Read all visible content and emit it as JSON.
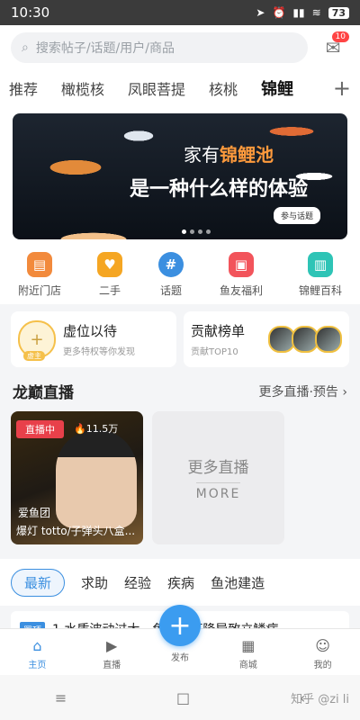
{
  "status": {
    "time": "10:30",
    "battery": "73"
  },
  "search": {
    "placeholder": "搜索帖子/话题/用户/商品",
    "badge": "10"
  },
  "tabs": [
    "推荐",
    "橄榄核",
    "凤眼菩提",
    "核桃",
    "锦鲤"
  ],
  "banner": {
    "line1_pre": "家有",
    "line1_em": "锦鲤池",
    "line2": "是一种什么样的体验",
    "button": "参与话题"
  },
  "categories": [
    {
      "label": "附近门店",
      "icon": "store-icon",
      "color": "#f28a3c"
    },
    {
      "label": "二手",
      "icon": "handshake-icon",
      "color": "#f5a623"
    },
    {
      "label": "话题",
      "icon": "hashtag-icon",
      "color": "#3b8fe0"
    },
    {
      "label": "鱼友福利",
      "icon": "gift-icon",
      "color": "#f2545b"
    },
    {
      "label": "锦鲤百科",
      "icon": "book-icon",
      "color": "#2ec4b6"
    }
  ],
  "seat_card": {
    "title": "虚位以待",
    "sub": "更多特权等你发现",
    "mini": "虚主"
  },
  "rank_card": {
    "title": "贡献榜单",
    "sub": "贡献TOP10"
  },
  "live_section": {
    "title": "龙巅直播",
    "more": "更多直播·预告"
  },
  "live_card": {
    "badge": "直播中",
    "viewers": "11.5万",
    "author": "爱鱼团",
    "title": "爆灯 totto/子弹头八盒..."
  },
  "more_live": {
    "a": "更多直播",
    "b": "MORE"
  },
  "feed_tabs": [
    "最新",
    "求助",
    "经验",
    "疾病",
    "鱼池建造"
  ],
  "post": {
    "pin": "置顶",
    "text": "1.水质波动过大，免疫力下降导致立鳞病。"
  },
  "nav": {
    "home": "主页",
    "live": "直播",
    "publish": "发布",
    "shop": "商城",
    "me": "我的"
  },
  "watermark": "知乎 @zi li"
}
